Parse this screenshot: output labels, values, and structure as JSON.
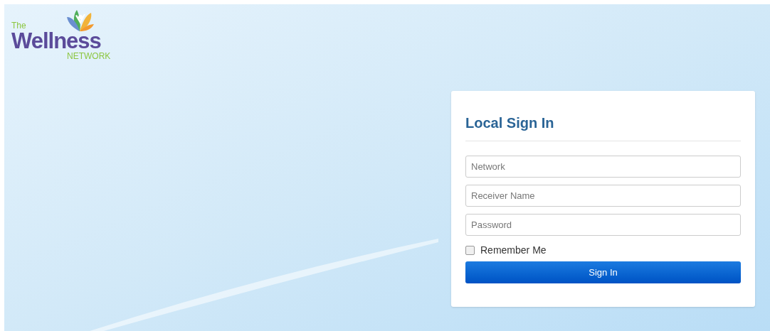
{
  "logo": {
    "small": "The",
    "main": "Wellness",
    "sub": "NETWORK"
  },
  "sign_in": {
    "title": "Local Sign In",
    "fields": [
      {
        "placeholder": "Network"
      },
      {
        "placeholder": "Receiver Name"
      },
      {
        "placeholder": "Password"
      }
    ],
    "remember": {
      "label": "Remember Me",
      "checked": false
    },
    "button": "Sign In"
  }
}
